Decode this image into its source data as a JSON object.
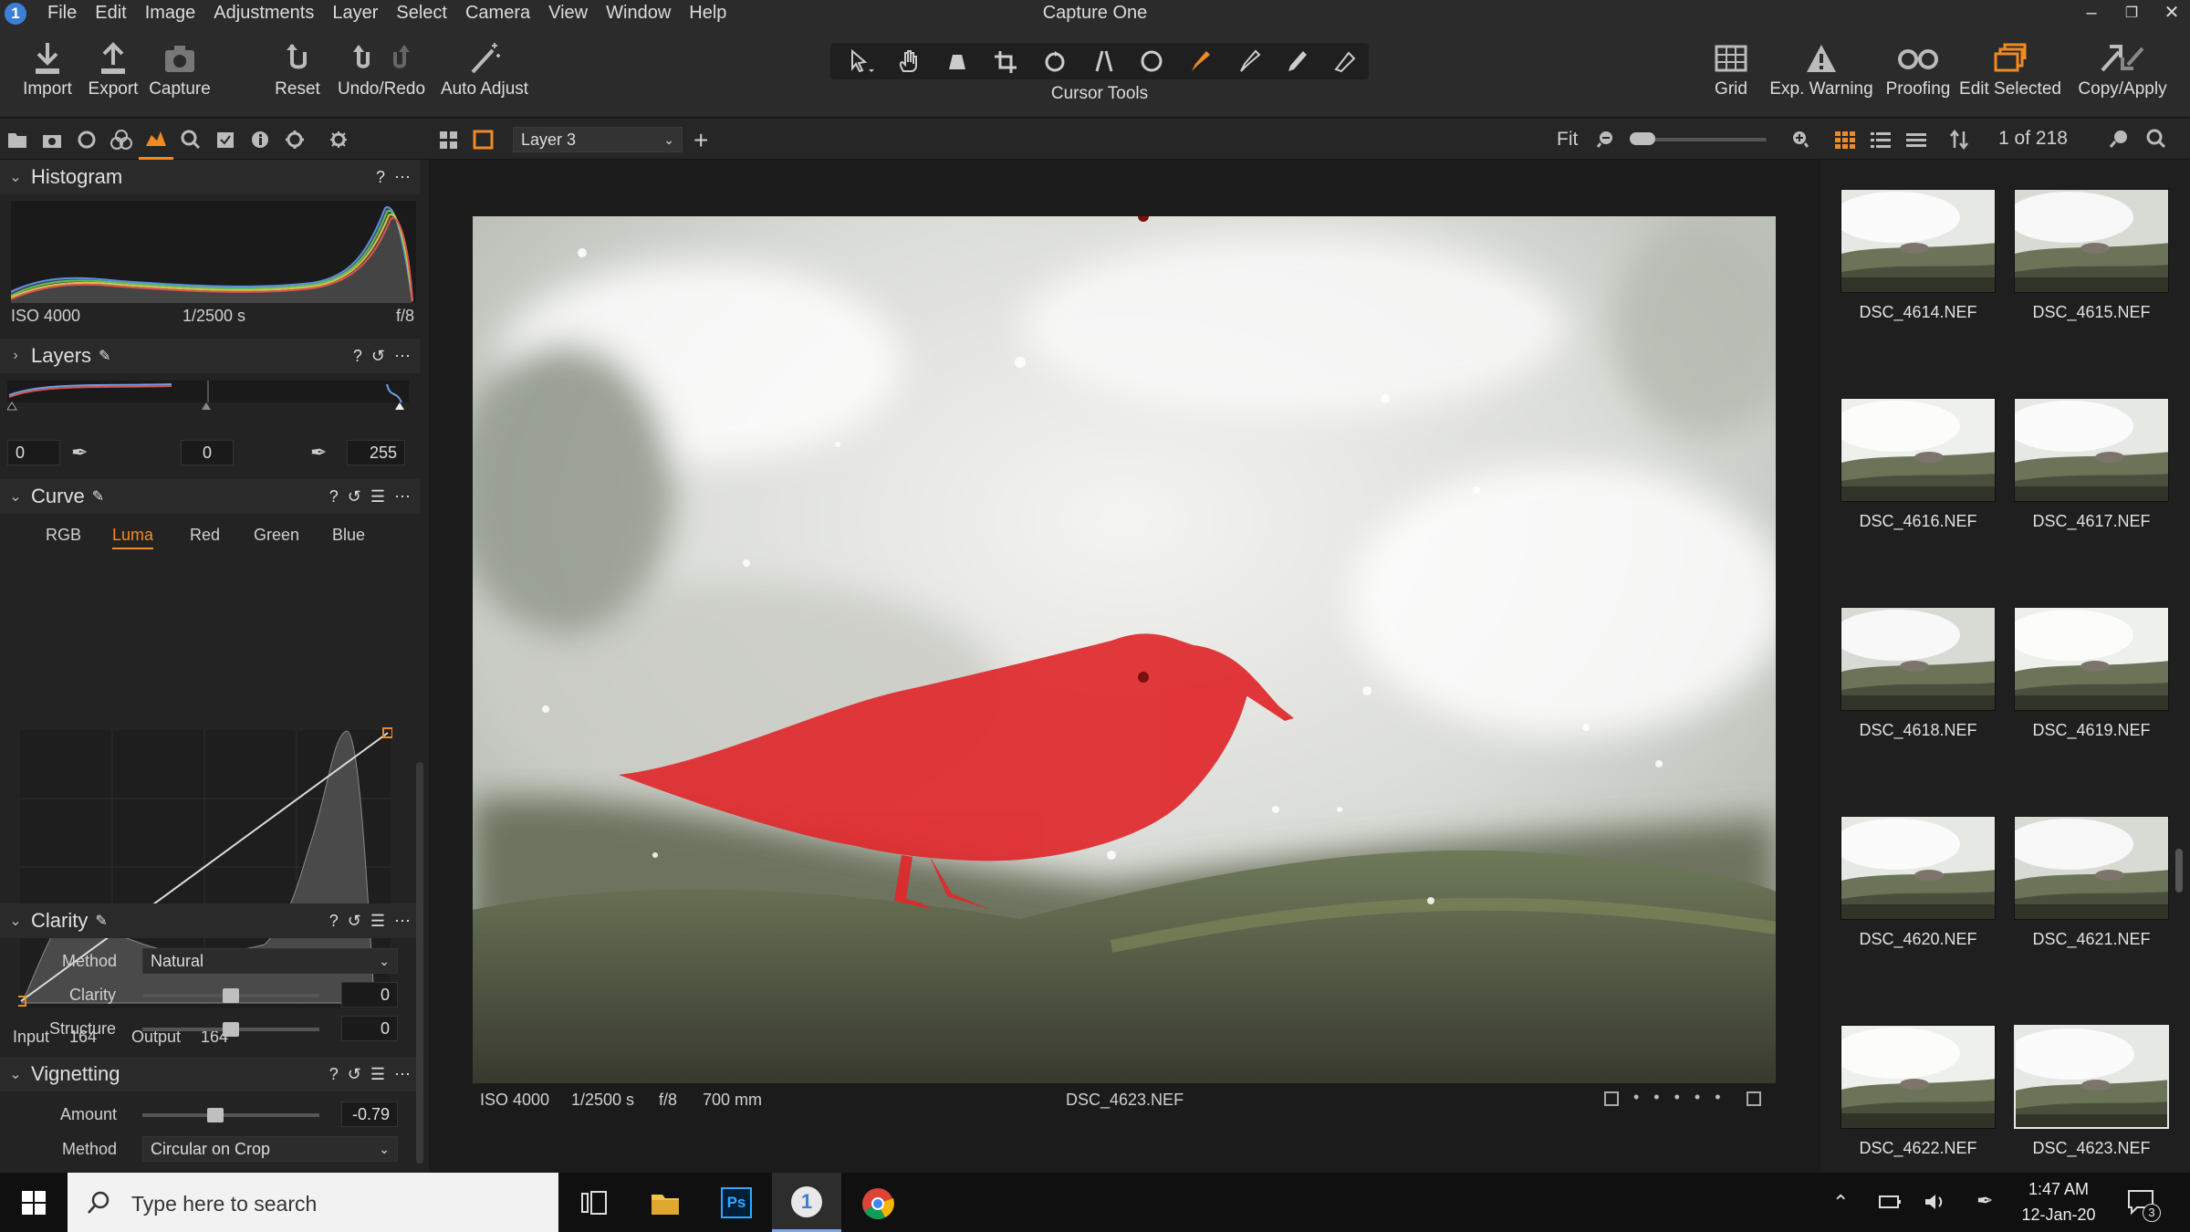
{
  "app": {
    "title": "Capture One"
  },
  "menu": [
    "File",
    "Edit",
    "Image",
    "Adjustments",
    "Layer",
    "Select",
    "Camera",
    "View",
    "Window",
    "Help"
  ],
  "toolbar": {
    "left": [
      {
        "label": "Import",
        "icon": "import-icon"
      },
      {
        "label": "Export",
        "icon": "export-icon"
      },
      {
        "label": "Capture",
        "icon": "camera-icon"
      },
      {
        "label": "Reset",
        "icon": "reset-icon"
      },
      {
        "label": "Undo/Redo",
        "icon": "undo-redo-icon"
      },
      {
        "label": "Auto Adjust",
        "icon": "magic-wand-icon"
      }
    ],
    "cursor_tools_label": "Cursor Tools",
    "right": [
      {
        "label": "Grid",
        "icon": "grid-icon"
      },
      {
        "label": "Exp. Warning",
        "icon": "warning-icon"
      },
      {
        "label": "Proofing",
        "icon": "glasses-icon"
      },
      {
        "label": "Edit Selected",
        "icon": "edit-selected-icon"
      },
      {
        "label": "Copy/Apply",
        "icon": "copy-apply-icon"
      }
    ]
  },
  "viewer_bar": {
    "layer": "Layer 3",
    "zoom": "Fit"
  },
  "browser_bar": {
    "count": "1 of 218"
  },
  "histogram": {
    "title": "Histogram",
    "iso": "ISO 4000",
    "shutter": "1/2500 s",
    "aperture": "f/8"
  },
  "layers": {
    "title": "Layers",
    "levels": {
      "low": "0",
      "mid": "0",
      "high": "255"
    }
  },
  "curve": {
    "title": "Curve",
    "tabs": [
      "RGB",
      "Luma",
      "Red",
      "Green",
      "Blue"
    ],
    "active_tab": "Luma",
    "input_label": "Input",
    "input": "164",
    "output_label": "Output",
    "output": "164"
  },
  "clarity": {
    "title": "Clarity",
    "method_label": "Method",
    "method": "Natural",
    "clarity_label": "Clarity",
    "clarity": "0",
    "structure_label": "Structure",
    "structure": "0"
  },
  "vignetting": {
    "title": "Vignetting",
    "amount_label": "Amount",
    "amount": "-0.79",
    "method_label": "Method",
    "method": "Circular on Crop"
  },
  "photo_info": {
    "iso": "ISO 4000",
    "shutter": "1/2500 s",
    "aperture": "f/8",
    "focal": "700 mm",
    "filename": "DSC_4623.NEF"
  },
  "thumbnails": [
    "DSC_4614.NEF",
    "DSC_4615.NEF",
    "DSC_4616.NEF",
    "DSC_4617.NEF",
    "DSC_4618.NEF",
    "DSC_4619.NEF",
    "DSC_4620.NEF",
    "DSC_4621.NEF",
    "DSC_4622.NEF",
    "DSC_4623.NEF"
  ],
  "selected_thumbnail": "DSC_4623.NEF",
  "taskbar": {
    "search_placeholder": "Type here to search",
    "time": "1:47 AM",
    "date": "12-Jan-20",
    "notifications": "3"
  },
  "colors": {
    "accent": "#f08a24",
    "mask": "#e0282c",
    "bg": "#1b1b1b"
  }
}
